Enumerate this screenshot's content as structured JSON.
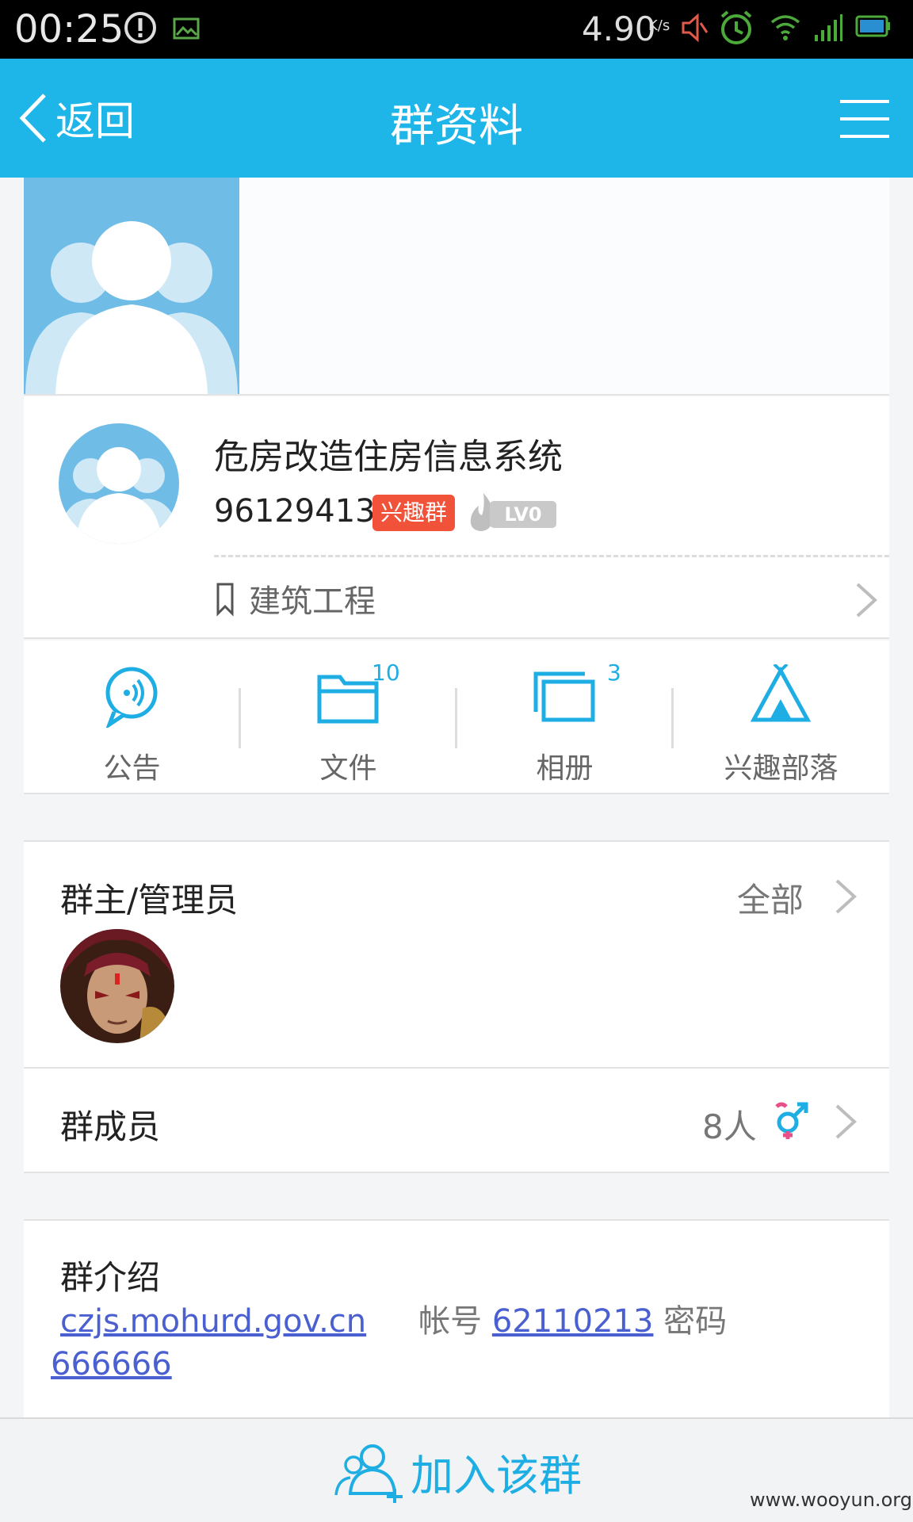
{
  "status_bar": {
    "time": "00:25",
    "net_speed": "4.90",
    "net_speed_unit": "K/s",
    "icons": [
      "alert-icon",
      "image-icon",
      "mute-icon",
      "alarm-icon",
      "wifi-icon",
      "signal-icon",
      "battery-icon"
    ]
  },
  "title_bar": {
    "back_label": "返回",
    "title": "群资料",
    "accent_color": "#1eb5e8"
  },
  "group": {
    "name": "危房改造住房信息系统",
    "id": "96129413",
    "tag": "兴趣群",
    "level": "LV0",
    "category": "建筑工程"
  },
  "actions": [
    {
      "label": "公告",
      "icon": "announcement-icon",
      "badge": ""
    },
    {
      "label": "文件",
      "icon": "folder-icon",
      "badge": "10"
    },
    {
      "label": "相册",
      "icon": "album-icon",
      "badge": "3"
    },
    {
      "label": "兴趣部落",
      "icon": "tribe-icon",
      "badge": ""
    }
  ],
  "admins": {
    "title": "群主/管理员",
    "all_label": "全部"
  },
  "members": {
    "title": "群成员",
    "count": "8人"
  },
  "intro": {
    "title": "群介绍",
    "site": "czjs.mohurd.gov.cn",
    "account_label": "帐号",
    "account": "62110213",
    "password_label": "密码",
    "password": "666666"
  },
  "join": {
    "label": "加入该群"
  },
  "watermark": "www.wooyun.org"
}
